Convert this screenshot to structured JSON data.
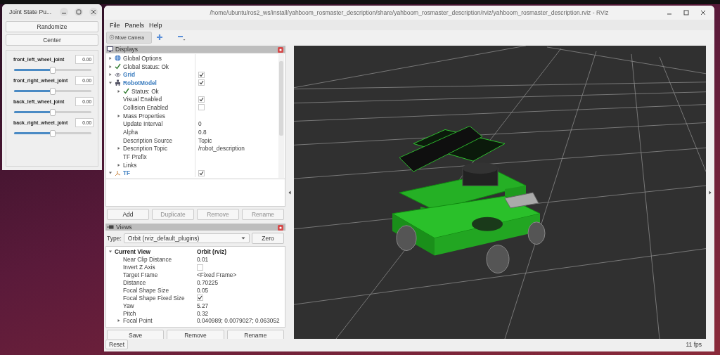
{
  "joint_window": {
    "title": "Joint State Pu...",
    "buttons": [
      "Randomize",
      "Center"
    ],
    "joints": [
      {
        "name": "front_left_wheel_joint",
        "value": "0.00",
        "level": 0.5
      },
      {
        "name": "front_right_wheel_joint",
        "value": "0.00",
        "level": 0.5
      },
      {
        "name": "back_left_wheel_joint",
        "value": "0.00",
        "level": 0.5
      },
      {
        "name": "back_right_wheel_joint",
        "value": "0.00",
        "level": 0.5
      }
    ]
  },
  "rviz": {
    "title": "/home/ubuntu/ros2_ws/install/yahboom_rosmaster_description/share/yahboom_rosmaster_description/rviz/yahboom_rosmaster_description.rviz - RViz",
    "menu": [
      "File",
      "Panels",
      "Help"
    ],
    "toolbar": {
      "tool": "Move Camera"
    },
    "displays": {
      "title": "Displays",
      "rows": [
        {
          "label": "Global Options",
          "kind": "options",
          "expanded": false
        },
        {
          "label": "Global Status: Ok",
          "kind": "status",
          "expanded": false
        },
        {
          "label": "Grid",
          "kind": "grid",
          "expanded": false,
          "checked": true
        },
        {
          "label": "RobotModel",
          "kind": "robot",
          "expanded": true,
          "checked": true,
          "children": [
            {
              "label": "Status: Ok",
              "kind": "status",
              "expanded": false
            },
            {
              "label": "Visual Enabled",
              "kind": "property",
              "checked": true
            },
            {
              "label": "Collision Enabled",
              "kind": "property",
              "checked": false
            },
            {
              "label": "Mass Properties",
              "kind": "property",
              "expanded": false
            },
            {
              "label": "Update Interval",
              "kind": "property",
              "value": "0"
            },
            {
              "label": "Alpha",
              "kind": "property",
              "value": "0.8"
            },
            {
              "label": "Description Source",
              "kind": "property",
              "value": "Topic"
            },
            {
              "label": "Description Topic",
              "kind": "property",
              "expanded": false,
              "value": "/robot_description"
            },
            {
              "label": "TF Prefix",
              "kind": "property"
            },
            {
              "label": "Links",
              "kind": "property",
              "expanded": false
            }
          ]
        },
        {
          "label": "TF",
          "kind": "tf",
          "expanded": true,
          "checked": true
        }
      ],
      "buttons": [
        {
          "label": "Add",
          "disabled": false
        },
        {
          "label": "Duplicate",
          "disabled": true
        },
        {
          "label": "Remove",
          "disabled": true
        },
        {
          "label": "Rename",
          "disabled": true
        }
      ]
    },
    "views": {
      "title": "Views",
      "type_label": "Type:",
      "type_value": "Orbit (rviz_default_plugins)",
      "zero": "Zero",
      "rows": [
        {
          "label": "Current View",
          "kind": "view",
          "expanded": true,
          "value": "Orbit (rviz)",
          "children": [
            {
              "label": "Near Clip Distance",
              "kind": "property",
              "value": "0.01"
            },
            {
              "label": "Invert Z Axis",
              "kind": "property",
              "checked": false
            },
            {
              "label": "Target Frame",
              "kind": "property",
              "value": "<Fixed Frame>"
            },
            {
              "label": "Distance",
              "kind": "property",
              "value": "0.70225"
            },
            {
              "label": "Focal Shape Size",
              "kind": "property",
              "value": "0.05"
            },
            {
              "label": "Focal Shape Fixed Size",
              "kind": "property",
              "checked": true
            },
            {
              "label": "Yaw",
              "kind": "property",
              "value": "5.27"
            },
            {
              "label": "Pitch",
              "kind": "property",
              "value": "0.32"
            },
            {
              "label": "Focal Point",
              "kind": "property",
              "expanded": false,
              "value": "0.040989; 0.0079027; 0.063052"
            }
          ]
        }
      ],
      "buttons": [
        "Save",
        "Remove",
        "Rename"
      ]
    },
    "status_bar": {
      "reset": "Reset",
      "fps": "11 fps"
    }
  }
}
